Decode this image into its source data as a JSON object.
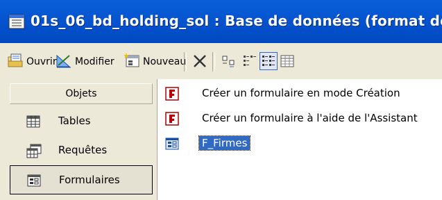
{
  "window": {
    "title": "01s_06_bd_holding_sol : Base de données (format de"
  },
  "toolbar": {
    "open_label": "Ouvrir",
    "modify_label": "Modifier",
    "new_label": "Nouveau"
  },
  "sidebar": {
    "header": "Objets",
    "items": [
      {
        "label": "Tables"
      },
      {
        "label": "Requêtes"
      },
      {
        "label": "Formulaires"
      }
    ]
  },
  "objects_list": [
    {
      "label": "Créer un formulaire en mode Création"
    },
    {
      "label": "Créer un formulaire à l'aide de l'Assistant"
    },
    {
      "label": "F_Firmes"
    }
  ]
}
